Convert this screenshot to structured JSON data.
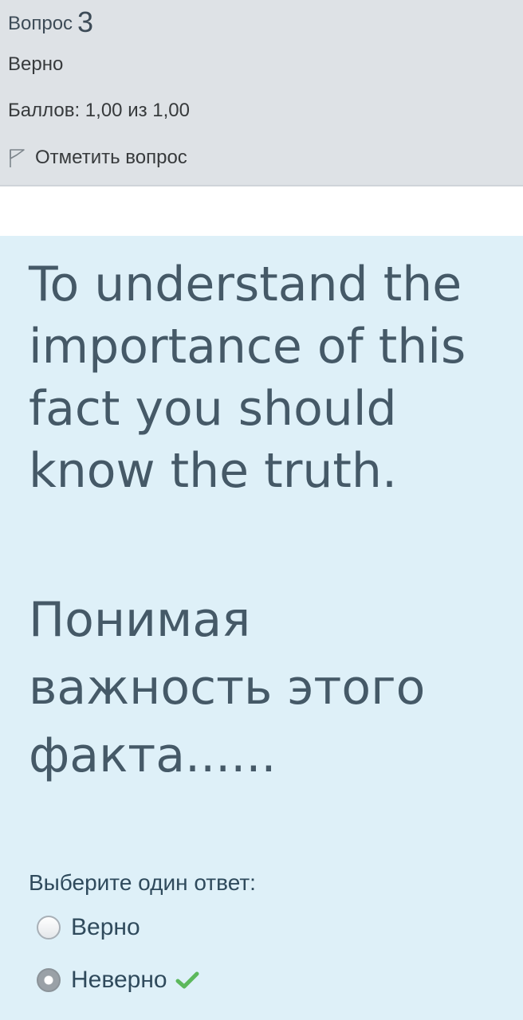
{
  "info": {
    "question_label": "Вопрос",
    "question_number": "3",
    "state": "Верно",
    "grade": "Баллов: 1,00 из 1,00",
    "flag_label": "Отметить вопрос"
  },
  "question": {
    "text_en": "To understand the importance of this fact you should know the truth.",
    "text_ru": "Понимая важность этого факта......"
  },
  "answer": {
    "prompt": "Выберите один ответ:",
    "options": [
      {
        "label": "Верно",
        "selected": false,
        "correct": false
      },
      {
        "label": "Неверно",
        "selected": true,
        "correct": true
      }
    ]
  },
  "colors": {
    "info_bg": "#dee2e6",
    "content_bg": "#def0f8",
    "text": "#455967",
    "correct_check": "#5cb85c"
  },
  "icons": {
    "flag": "flag-icon",
    "correct": "check-icon"
  }
}
